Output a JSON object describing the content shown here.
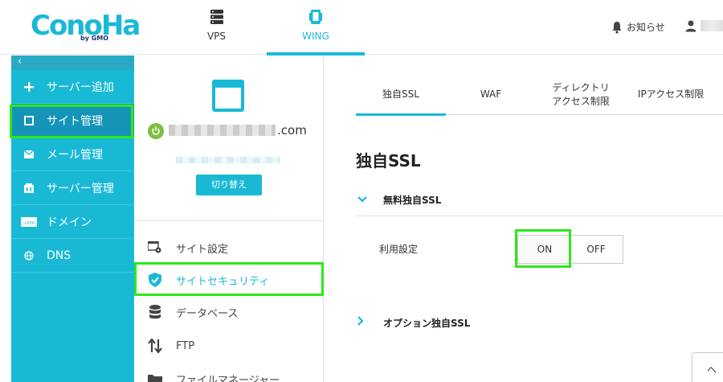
{
  "header": {
    "logo_text": "ConoHa",
    "logo_sub": "by GMO",
    "nav": [
      {
        "label": "VPS",
        "icon": "server-icon"
      },
      {
        "label": "WING",
        "icon": "phone-icon"
      }
    ],
    "notice_label": "お知らせ",
    "user_icon": "user-icon"
  },
  "sidebar": {
    "collapse_label": "‹",
    "items": [
      {
        "label": "サーバー追加",
        "icon": "plus-icon"
      },
      {
        "label": "サイト管理",
        "icon": "site-icon"
      },
      {
        "label": "メール管理",
        "icon": "mail-icon"
      },
      {
        "label": "サーバー管理",
        "icon": "server-manage-icon"
      },
      {
        "label": "ドメイン",
        "icon": "domain-icon"
      },
      {
        "label": "DNS",
        "icon": "globe-icon"
      }
    ]
  },
  "site_panel": {
    "domain_suffix": ".com",
    "switch_label": "切り替え",
    "menu": [
      {
        "label": "サイト設定",
        "icon": "site-settings-icon"
      },
      {
        "label": "サイトセキュリティ",
        "icon": "shield-check-icon"
      },
      {
        "label": "データベース",
        "icon": "database-icon"
      },
      {
        "label": "FTP",
        "icon": "transfer-arrows-icon"
      },
      {
        "label": "ファイルマネージャー",
        "icon": "folder-icon"
      }
    ]
  },
  "main": {
    "tabs": [
      {
        "label": "独自SSL"
      },
      {
        "label": "WAF"
      },
      {
        "label_line1": "ディレクトリ",
        "label_line2": "アクセス制限"
      },
      {
        "label": "IPアクセス制限"
      }
    ],
    "title": "独自SSL",
    "free_ssl_section": "無料独自SSL",
    "setting_label": "利用設定",
    "toggle_on": "ON",
    "toggle_off": "OFF",
    "option_ssl_section": "オプション独自SSL",
    "help_label": "ヘ"
  },
  "colors": {
    "brand": "#19b9d6",
    "sidebar_active": "#1594b8",
    "highlight": "#2ee81a",
    "power_green": "#7bc142"
  }
}
